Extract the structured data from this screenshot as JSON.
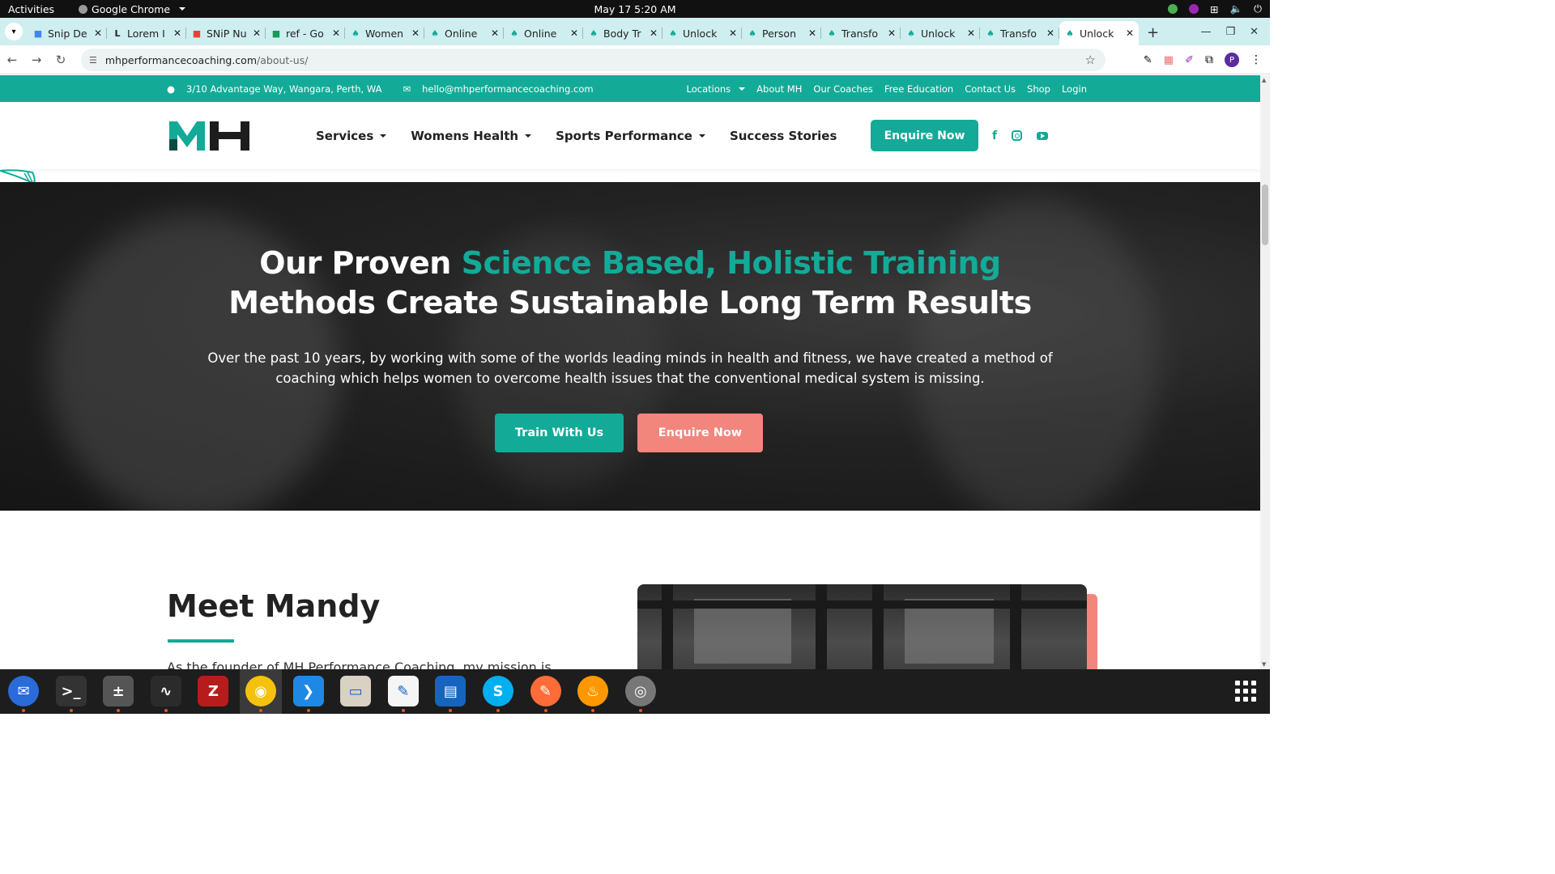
{
  "system": {
    "activities": "Activities",
    "app_name": "Google Chrome",
    "clock": "May 17  5:20 AM"
  },
  "browser": {
    "tabs": [
      {
        "label": "Snip De",
        "icon": "doc-icon",
        "color": "#4285f4"
      },
      {
        "label": "Lorem I",
        "icon": "lorem-icon",
        "color": "#222222"
      },
      {
        "label": "SNiP Nu",
        "icon": "chrome-like-icon",
        "color": "#e94235"
      },
      {
        "label": "ref - Go",
        "icon": "sheets-icon",
        "color": "#0f9d58"
      },
      {
        "label": "Women",
        "icon": "mh-icon",
        "color": "#13aa98"
      },
      {
        "label": "Online",
        "icon": "mh-icon",
        "color": "#13aa98"
      },
      {
        "label": "Online",
        "icon": "mh-icon",
        "color": "#13aa98"
      },
      {
        "label": "Body Tr",
        "icon": "mh-icon",
        "color": "#13aa98"
      },
      {
        "label": "Unlock",
        "icon": "mh-icon",
        "color": "#13aa98"
      },
      {
        "label": "Person",
        "icon": "mh-icon",
        "color": "#13aa98"
      },
      {
        "label": "Transfo",
        "icon": "mh-icon",
        "color": "#13aa98"
      },
      {
        "label": "Unlock",
        "icon": "mh-icon",
        "color": "#13aa98"
      },
      {
        "label": "Transfo",
        "icon": "mh-icon",
        "color": "#13aa98"
      },
      {
        "label": "Unlock",
        "icon": "mh-icon",
        "color": "#13aa98",
        "active": true
      }
    ],
    "url_host": "mhperformancecoaching.com",
    "url_path": "/about-us/",
    "profile_initial": "P"
  },
  "site": {
    "brand_color": "#13aa98",
    "accent_color": "#f2867d",
    "info_bar": {
      "address": "3/10 Advantage Way, Wangara, Perth, WA",
      "email": "hello@mhperformancecoaching.com",
      "links": [
        "Locations",
        "About MH",
        "Our Coaches",
        "Free Education",
        "Contact Us",
        "Shop",
        "Login"
      ]
    },
    "nav": {
      "items": [
        {
          "label": "Services",
          "dropdown": true
        },
        {
          "label": "Womens Health",
          "dropdown": true
        },
        {
          "label": "Sports Performance",
          "dropdown": true
        },
        {
          "label": "Success Stories",
          "dropdown": false
        }
      ],
      "cta": "Enquire Now",
      "socials": [
        "facebook-icon",
        "instagram-icon",
        "youtube-icon"
      ]
    },
    "hero": {
      "title_part1": "Our Proven ",
      "title_accent": "Science Based, Holistic Training",
      "title_line2": "Methods Create Sustainable Long Term Results",
      "body": "Over the past 10 years, by working with some of the worlds leading minds in health and fitness, we have created a method of coaching which helps women to overcome health issues that the conventional medical system is missing.",
      "btn_primary": "Train With Us",
      "btn_secondary": "Enquire Now"
    },
    "meet": {
      "title": "Meet Mandy",
      "body_partial": "As the founder of MH Performance Coaching, my mission is"
    }
  },
  "dock": {
    "apps": [
      "thunderbird-icon",
      "terminal-icon",
      "calculator-icon",
      "system-monitor-icon",
      "filezilla-icon",
      "chrome-icon",
      "vscode-icon",
      "files-icon",
      "text-editor-icon",
      "libreoffice-writer-icon",
      "skype-icon",
      "postman-icon",
      "app-flame-icon",
      "disk-icon"
    ]
  }
}
